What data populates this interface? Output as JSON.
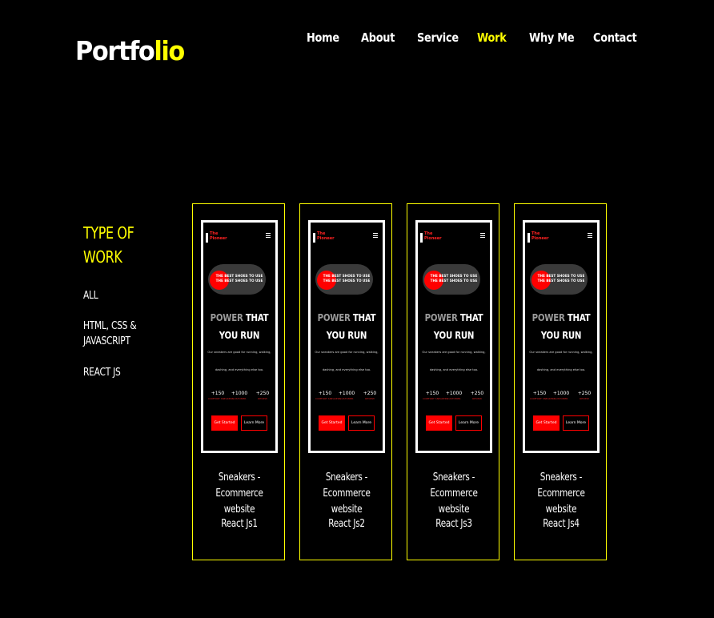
{
  "header": {
    "logo_main": "Portfo",
    "logo_highlight": "lio",
    "nav": [
      {
        "label": "Home",
        "active": false
      },
      {
        "label": "About",
        "active": false
      },
      {
        "label": "Service",
        "active": false
      },
      {
        "label": "Work",
        "active": true
      },
      {
        "label": "Why Me",
        "active": false
      },
      {
        "label": "Contact",
        "active": false
      }
    ]
  },
  "sidebar": {
    "title_line1": "TYPE OF",
    "title_line2": "WORK",
    "filters": [
      {
        "line1": "ALL",
        "line2": ""
      },
      {
        "line1": "HTML, CSS &",
        "line2": "JAVASCRIPT"
      },
      {
        "line1": "REACT JS",
        "line2": ""
      }
    ]
  },
  "preview": {
    "brand_line1": "The",
    "brand_line2": "Pioneer",
    "pill_text": "THE BEST SHOES TO USE THE BEST SHOES TO USE",
    "headline_gray": "POWER",
    "headline_rest": " THAT",
    "headline_line2": "YOU RUN",
    "body_line1": "Our sneakers are good for running, walking,",
    "body_line2": "dashing, and everything else too.",
    "stats": [
      {
        "value": "+150",
        "label": "COMFORT SNEAKERS"
      },
      {
        "value": "+1000",
        "label": "CUSTOMER"
      },
      {
        "value": "+250",
        "label": "REVIEW"
      }
    ],
    "primary_button": "Get Started",
    "secondary_button": "Learn More"
  },
  "cards": [
    {
      "title_line1": "Sneakers - Ecommerce",
      "title_line2": "website",
      "subtitle": "React Js1"
    },
    {
      "title_line1": "Sneakers - Ecommerce",
      "title_line2": "website",
      "subtitle": "React Js2"
    },
    {
      "title_line1": "Sneakers - Ecommerce",
      "title_line2": "website",
      "subtitle": "React Js3"
    },
    {
      "title_line1": "Sneakers - Ecommerce",
      "title_line2": "website",
      "subtitle": "React Js4"
    }
  ],
  "colors": {
    "accent": "#ffff00",
    "background": "#000000",
    "preview_red": "#ff0000"
  }
}
